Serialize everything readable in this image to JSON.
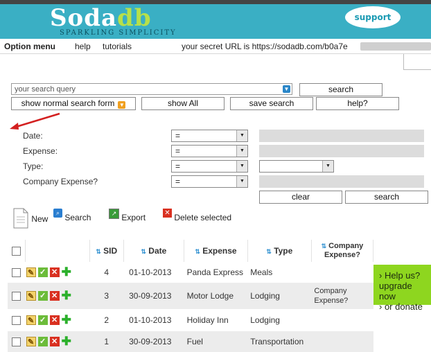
{
  "header": {
    "logo_main": "Soda",
    "logo_accent": "db",
    "tagline": "SPARKLING SIMPLICITY",
    "support": "support"
  },
  "menu": {
    "option_menu": "Option menu",
    "help": "help",
    "tutorials": "tutorials",
    "secret_url": "your secret URL is https://sodadb.com/b0a7e"
  },
  "search": {
    "query_value": "your search query",
    "search_button": "search",
    "show_normal_form": "show normal search form",
    "show_all": "show All",
    "save_search": "save search",
    "help": "help?"
  },
  "filters": [
    {
      "label": "Date:",
      "op": "="
    },
    {
      "label": "Expense:",
      "op": "="
    },
    {
      "label": "Type:",
      "op": "="
    },
    {
      "label": "Company Expense?",
      "op": "="
    }
  ],
  "filter_buttons": {
    "clear": "clear",
    "search": "search"
  },
  "toolbar": {
    "new": "New",
    "search": "Search",
    "export": "Export",
    "delete_selected": "Delete selected"
  },
  "table": {
    "headers": {
      "sid": "SID",
      "date": "Date",
      "expense": "Expense",
      "type": "Type",
      "company_expense": "Company Expense?"
    },
    "rows": [
      {
        "sid": "4",
        "date": "01-10-2013",
        "expense": "Panda Express",
        "type": "Meals",
        "company_expense": ""
      },
      {
        "sid": "3",
        "date": "30-09-2013",
        "expense": "Motor Lodge",
        "type": "Lodging",
        "company_expense": "Company Expense?"
      },
      {
        "sid": "2",
        "date": "01-10-2013",
        "expense": "Holiday Inn",
        "type": "Lodging",
        "company_expense": ""
      },
      {
        "sid": "1",
        "date": "30-09-2013",
        "expense": "Fuel",
        "type": "Transportation",
        "company_expense": ""
      }
    ]
  },
  "helpbox": {
    "line1": "› Help us?",
    "line2": "upgrade now",
    "line3": "› or donate"
  },
  "colors": {
    "header_bg": "#3aafc4",
    "help_bg": "#8ed61f",
    "arrow": "#d32020"
  }
}
